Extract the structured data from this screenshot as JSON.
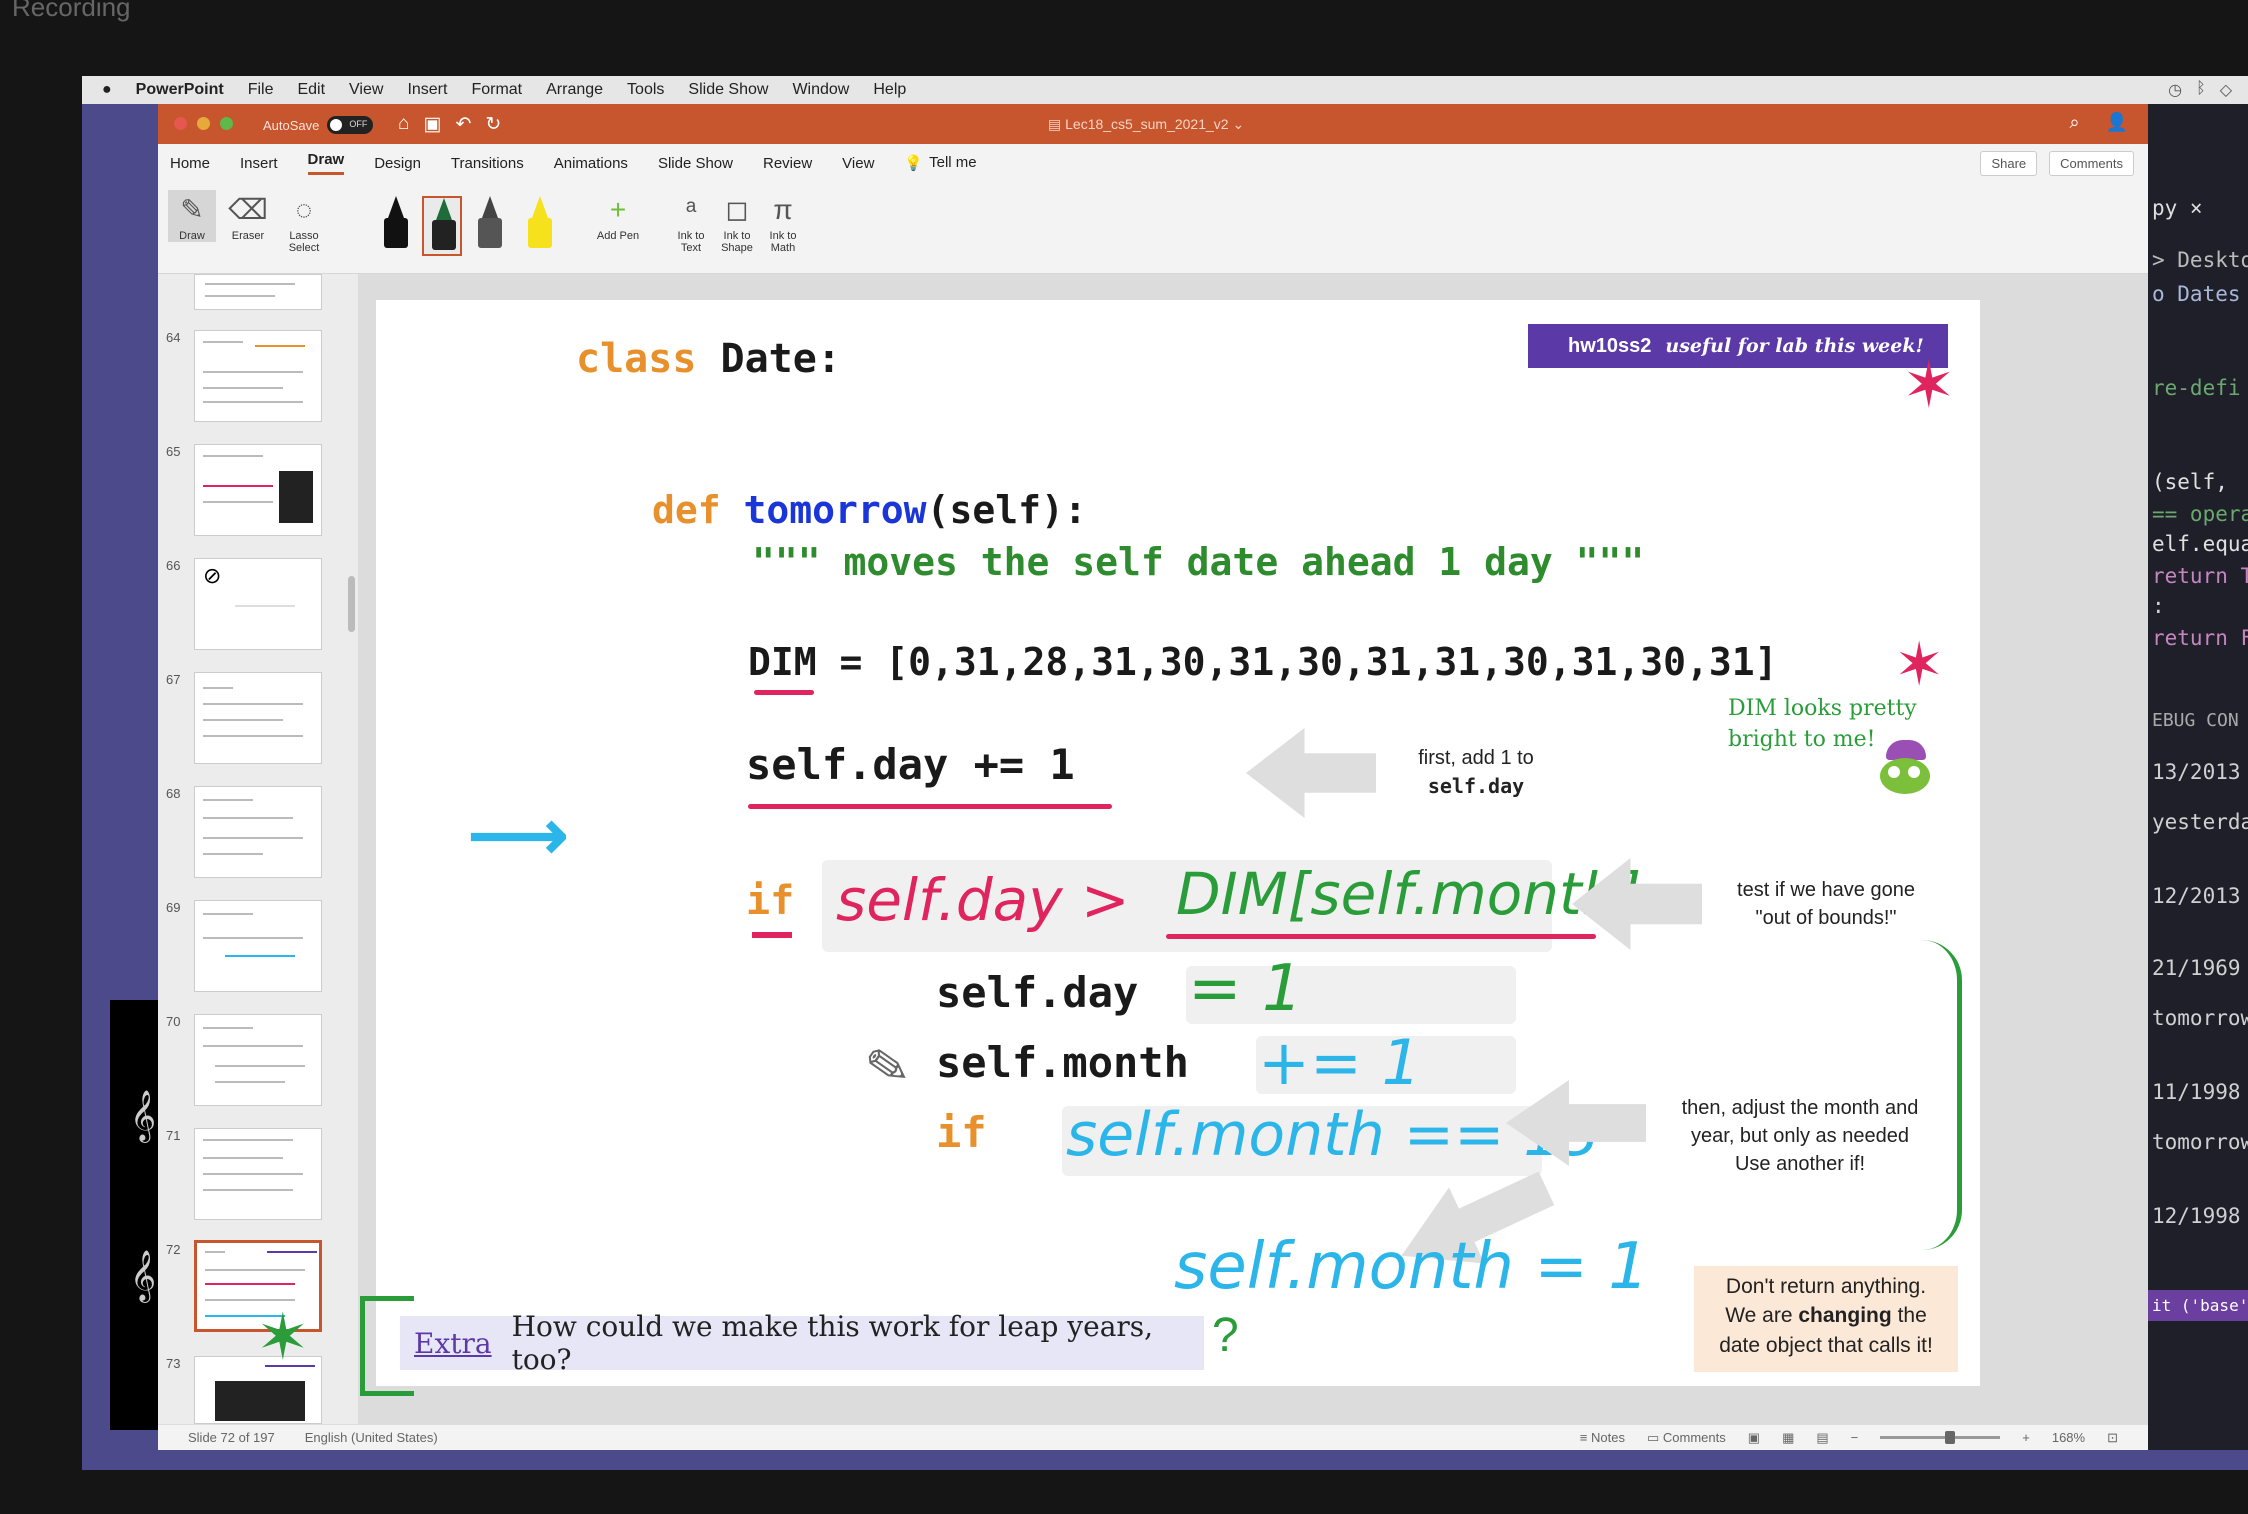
{
  "recording_label": "Recording",
  "menubar": {
    "apple": "",
    "items": [
      "PowerPoint",
      "File",
      "Edit",
      "View",
      "Insert",
      "Format",
      "Arrange",
      "Tools",
      "Slide Show",
      "Window",
      "Help"
    ]
  },
  "titlebar": {
    "autosave": "AutoSave",
    "toggle": "OFF",
    "doc_title": "Lec18_cs5_sum_2021_v2"
  },
  "tabs": [
    "Home",
    "Insert",
    "Draw",
    "Design",
    "Transitions",
    "Animations",
    "Slide Show",
    "Review",
    "View"
  ],
  "tell_me": "Tell me",
  "share": "Share",
  "comments": "Comments",
  "ribbon": {
    "draw": "Draw",
    "eraser": "Eraser",
    "lasso_1": "Lasso",
    "lasso_2": "Select",
    "add_pen_1": "Add Pen",
    "ink_text_1": "Ink to",
    "ink_text_2": "Text",
    "ink_shape_1": "Ink to",
    "ink_shape_2": "Shape",
    "ink_math_1": "Ink to",
    "ink_math_2": "Math"
  },
  "thumbnails": [
    "64",
    "65",
    "66",
    "67",
    "68",
    "69",
    "70",
    "71",
    "72",
    "73"
  ],
  "slide": {
    "class_kw": "class",
    "class_name": "Date:",
    "banner_tag": "hw10ss2",
    "banner_text": "useful for lab this week!",
    "def_kw": "def",
    "fn_name": "tomorrow",
    "fn_args": "(self):",
    "docstring": "\"\"\" moves the self date ahead 1 day \"\"\"",
    "dim_line": "DIM = [0,31,28,31,30,31,30,31,31,30,31,30,31]",
    "dim_note_1": "DIM looks pretty",
    "dim_note_2": "bright to me!",
    "day_inc": "self.day += 1",
    "first_note_1": "first, add 1 to",
    "first_note_2": "self.day",
    "if_kw": "if",
    "hand_cond_1": "self.day >",
    "hand_cond_2": "DIM[self.month]:",
    "bounds_note_1": "test if we have gone",
    "bounds_note_2": "\"out of bounds!\"",
    "self_day": "self.day",
    "hand_eq1": "= 1",
    "self_month": "self.month",
    "hand_pluseq": "+= 1",
    "if2_kw": "if",
    "hand_month13": "self.month == 13",
    "hand_month_eq1": "self.month = 1",
    "then_note_1": "then, adjust the month and",
    "then_note_2": "year, but only as needed",
    "then_note_3": "Use another if!",
    "dont_note_1": "Don't return anything.",
    "dont_note_2a": "We are",
    "dont_note_2b": "changing",
    "dont_note_2c": "the",
    "dont_note_3": "date object that calls it!",
    "extra_label": "Extra",
    "extra_text": "How could we make this work for leap years, too?"
  },
  "status": {
    "slide": "Slide 72 of 197",
    "lang": "English (United States)",
    "notes": "Notes",
    "comments": "Comments",
    "zoom": "168%"
  },
  "editor": {
    "lines": [
      "py ×",
      "> Deskto",
      "o Dates",
      "re-defi",
      "(self,",
      "== opera",
      "elf.equa",
      "return T",
      ":",
      "return F",
      "EBUG CON",
      "13/2013",
      "yesterda",
      "12/2013",
      "21/1969",
      "tomorrow",
      "11/1998",
      "tomorrow",
      "12/1998",
      "it ('base': c"
    ]
  },
  "colors": {
    "accent": "#c7552d",
    "keyword": "#e8902b",
    "function": "#1a36d8",
    "string": "#2e8b2e",
    "ink_red": "#e0245e",
    "ink_green": "#2a9d3a",
    "ink_blue": "#2bb5e8",
    "banner": "#5b3aa8"
  }
}
